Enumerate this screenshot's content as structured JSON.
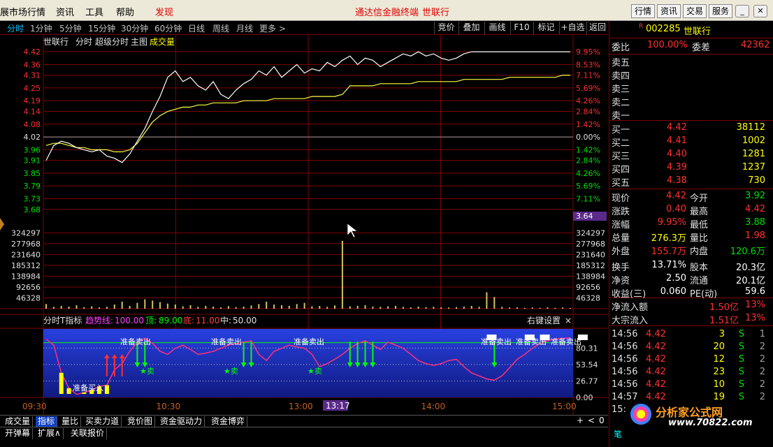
{
  "menu": {
    "items": [
      "展市场行情",
      "资讯",
      "工具",
      "帮助",
      "发现"
    ],
    "center_title": "通达信金融终端",
    "stock_title": "世联行",
    "right_buttons": [
      "行情",
      "资讯",
      "交易",
      "服务"
    ]
  },
  "periods": {
    "items": [
      "分时",
      "1分钟",
      "5分钟",
      "15分钟",
      "30分钟",
      "60分钟",
      "日线",
      "周线",
      "月线",
      "更多 >"
    ],
    "tools": [
      "竞价",
      "叠加",
      "画线",
      "F10",
      "标记",
      "+自选",
      "返回"
    ]
  },
  "chart_data": [
    {
      "type": "line",
      "title": "世联行",
      "labels": [
        "分时",
        "超级分时",
        "主图",
        "成交量"
      ],
      "y_ticks": [
        4.42,
        4.36,
        4.31,
        4.25,
        4.19,
        4.14,
        4.08,
        4.02,
        3.96,
        3.91,
        3.85,
        3.79,
        3.73,
        3.68
      ],
      "pct_ticks": [
        "9.95%",
        "8.53%",
        "7.11%",
        "5.69%",
        "4.26%",
        "2.84%",
        "1.42%",
        "0.00%",
        "1.42%",
        "2.84%",
        "4.26%",
        "5.69%",
        "7.11%"
      ],
      "ylim": [
        3.64,
        4.43
      ],
      "cursor_value": "3.64",
      "series": [
        {
          "values": [
            3.91,
            3.98,
            4.0,
            3.99,
            3.97,
            3.96,
            3.95,
            3.96,
            3.93,
            3.92,
            3.9,
            3.94,
            4.0,
            4.06,
            4.14,
            4.21,
            4.3,
            4.33,
            4.28,
            4.3,
            4.26,
            4.24,
            4.28,
            4.22,
            4.2,
            4.24,
            4.27,
            4.29,
            4.33,
            4.31,
            4.35,
            4.3,
            4.33,
            4.36,
            4.32,
            4.34,
            4.33,
            4.37,
            4.35,
            4.38,
            4.4,
            4.36,
            4.39,
            4.38,
            4.35,
            4.37,
            4.39,
            4.41,
            4.4,
            4.42,
            4.4,
            4.41,
            4.39,
            4.38,
            4.39,
            4.41,
            4.42,
            4.42,
            4.42,
            4.42,
            4.42,
            4.42,
            4.42,
            4.42,
            4.42,
            4.42,
            4.42,
            4.42,
            4.42,
            4.42
          ]
        },
        {
          "values": [
            3.98,
            3.99,
            3.99,
            3.98,
            3.97,
            3.97,
            3.96,
            3.96,
            3.96,
            3.95,
            3.95,
            3.96,
            3.99,
            4.04,
            4.09,
            4.12,
            4.14,
            4.15,
            4.16,
            4.16,
            4.17,
            4.17,
            4.18,
            4.18,
            4.18,
            4.18,
            4.19,
            4.19,
            4.19,
            4.19,
            4.2,
            4.2,
            4.2,
            4.2,
            4.2,
            4.21,
            4.21,
            4.21,
            4.21,
            4.22,
            4.26,
            4.26,
            4.26,
            4.26,
            4.27,
            4.27,
            4.27,
            4.27,
            4.27,
            4.28,
            4.28,
            4.28,
            4.28,
            4.28,
            4.28,
            4.29,
            4.29,
            4.29,
            4.29,
            4.29,
            4.29,
            4.3,
            4.3,
            4.3,
            4.3,
            4.3,
            4.3,
            4.3,
            4.31,
            4.31
          ]
        }
      ]
    },
    {
      "type": "bar",
      "title": "成交量",
      "y_ticks": [
        324297,
        277968,
        231640,
        185312,
        138984,
        92656,
        46328
      ],
      "ylim": [
        0,
        370000
      ],
      "values": [
        20000,
        8000,
        12000,
        9000,
        15000,
        7000,
        10000,
        6000,
        8000,
        18000,
        30000,
        12000,
        25000,
        40000,
        35000,
        28000,
        22000,
        18000,
        10000,
        15000,
        8000,
        12000,
        9000,
        6000,
        11000,
        7000,
        9000,
        14000,
        20000,
        30000,
        18000,
        15000,
        12000,
        20000,
        25000,
        10000,
        12000,
        8000,
        14000,
        290000,
        10000,
        12000,
        15000,
        9000,
        8000,
        10000,
        12000,
        8000,
        6000,
        9000,
        7000,
        8000,
        6000,
        5000,
        7000,
        9000,
        12000,
        8000,
        70000,
        50000,
        8000,
        5000,
        6000,
        4000,
        5000,
        4000,
        6000,
        4000,
        5000,
        3000
      ]
    },
    {
      "type": "line",
      "title": "分时T指标",
      "params": [
        "趋势线:",
        "100.00",
        "顶:",
        "89.00",
        "底:",
        "11.00",
        "中:",
        "50.00"
      ],
      "right_label": "右键设置",
      "y_ticks": [
        "80.31",
        "53.54",
        "26.77",
        "0.00"
      ],
      "ylim": [
        0,
        100
      ],
      "x_ticks": [
        "09:30",
        "10:30",
        "13:00",
        "14:00",
        "15:00"
      ],
      "cursor_time": "13:17",
      "signals": [
        "准备卖出",
        "准备卖出",
        "准备卖出",
        "准备卖出",
        "准备卖出",
        "准备卖出",
        "准备买入",
        "★卖",
        "★卖",
        "★卖"
      ],
      "series": [
        {
          "values": [
            95,
            85,
            40,
            15,
            5,
            8,
            12,
            18,
            20,
            45,
            55,
            75,
            90,
            96,
            88,
            75,
            70,
            80,
            85,
            78,
            70,
            72,
            75,
            80,
            85,
            88,
            90,
            92,
            70,
            60,
            75,
            80,
            85,
            82,
            80,
            70,
            50,
            55,
            62,
            70,
            80,
            88,
            92,
            85,
            78,
            90,
            85,
            80,
            70,
            60,
            55,
            52,
            55,
            60,
            62,
            50,
            40,
            35,
            30,
            28,
            35,
            48,
            62,
            70,
            80,
            88,
            92,
            95,
            96,
            97
          ]
        }
      ]
    }
  ],
  "quote": {
    "code": "002285",
    "name": "世联行",
    "webi_label": "委比",
    "webi_val": "100.00%",
    "weicha_label": "委差",
    "weicha_val": "42362",
    "sells": [
      "卖五",
      "卖四",
      "卖三",
      "卖二",
      "卖一"
    ],
    "buys": [
      {
        "label": "买一",
        "price": "4.42",
        "vol": "38112"
      },
      {
        "label": "买二",
        "price": "4.41",
        "vol": "1002"
      },
      {
        "label": "买三",
        "price": "4.40",
        "vol": "1281"
      },
      {
        "label": "买四",
        "price": "4.39",
        "vol": "1237"
      },
      {
        "label": "买五",
        "price": "4.38",
        "vol": "730"
      }
    ],
    "stats": [
      {
        "l1": "现价",
        "v1": "4.42",
        "l2": "今开",
        "v2": "3.92"
      },
      {
        "l1": "涨跌",
        "v1": "0.40",
        "l2": "最高",
        "v2": "4.42"
      },
      {
        "l1": "涨幅",
        "v1": "9.95%",
        "l2": "最低",
        "v2": "3.88"
      },
      {
        "l1": "总量",
        "v1": "276.3万",
        "l2": "量比",
        "v2": "1.98"
      },
      {
        "l1": "外盘",
        "v1": "155.7万",
        "l2": "内盘",
        "v2": "120.6万"
      },
      {
        "l1": "换手",
        "v1": "13.71%",
        "l2": "股本",
        "v2": "20.3亿"
      },
      {
        "l1": "净资",
        "v1": "2.50",
        "l2": "流通",
        "v2": "20.1亿"
      },
      {
        "l1": "收益(三)",
        "v1": "0.060",
        "l2": "PE(动)",
        "v2": "59.6"
      }
    ],
    "flow": [
      {
        "label": "净流入额",
        "val": "1.50亿",
        "pct": "13%"
      },
      {
        "label": "大宗流入",
        "val": "1.51亿",
        "pct": "13%"
      }
    ],
    "ticks": [
      {
        "t": "14:56",
        "p": "4.42",
        "v": "3",
        "s": "S",
        "n": "1"
      },
      {
        "t": "14:56",
        "p": "4.42",
        "v": "20",
        "s": "S",
        "n": "2"
      },
      {
        "t": "14:56",
        "p": "4.42",
        "v": "12",
        "s": "S",
        "n": "2"
      },
      {
        "t": "14:56",
        "p": "4.42",
        "v": "23",
        "s": "S",
        "n": "2"
      },
      {
        "t": "14:56",
        "p": "4.42",
        "v": "10",
        "s": "S",
        "n": "2"
      },
      {
        "t": "14:57",
        "p": "4.42",
        "v": "19",
        "s": "S",
        "n": "2"
      },
      {
        "t": "15:",
        "p": "",
        "v": "",
        "s": "",
        "n": ""
      }
    ],
    "logo": "分析家公式网",
    "logo_url": "www.70822.com",
    "bottom_glyph": "笔"
  },
  "bottom": {
    "tabs": [
      "成交量",
      "指标",
      "量比",
      "买卖力道",
      "竞价图",
      "资金驱动力",
      "资金博弈"
    ],
    "tabs2": [
      "开弹幕",
      "扩展∧",
      "关联报价"
    ],
    "controls": [
      "+",
      "<",
      "0"
    ]
  },
  "colors": {
    "up": "#ff3030",
    "down": "#00e000",
    "yellow": "#ffff00",
    "grid": "#800000",
    "price": "#ffffff",
    "avg": "#ffff40"
  }
}
